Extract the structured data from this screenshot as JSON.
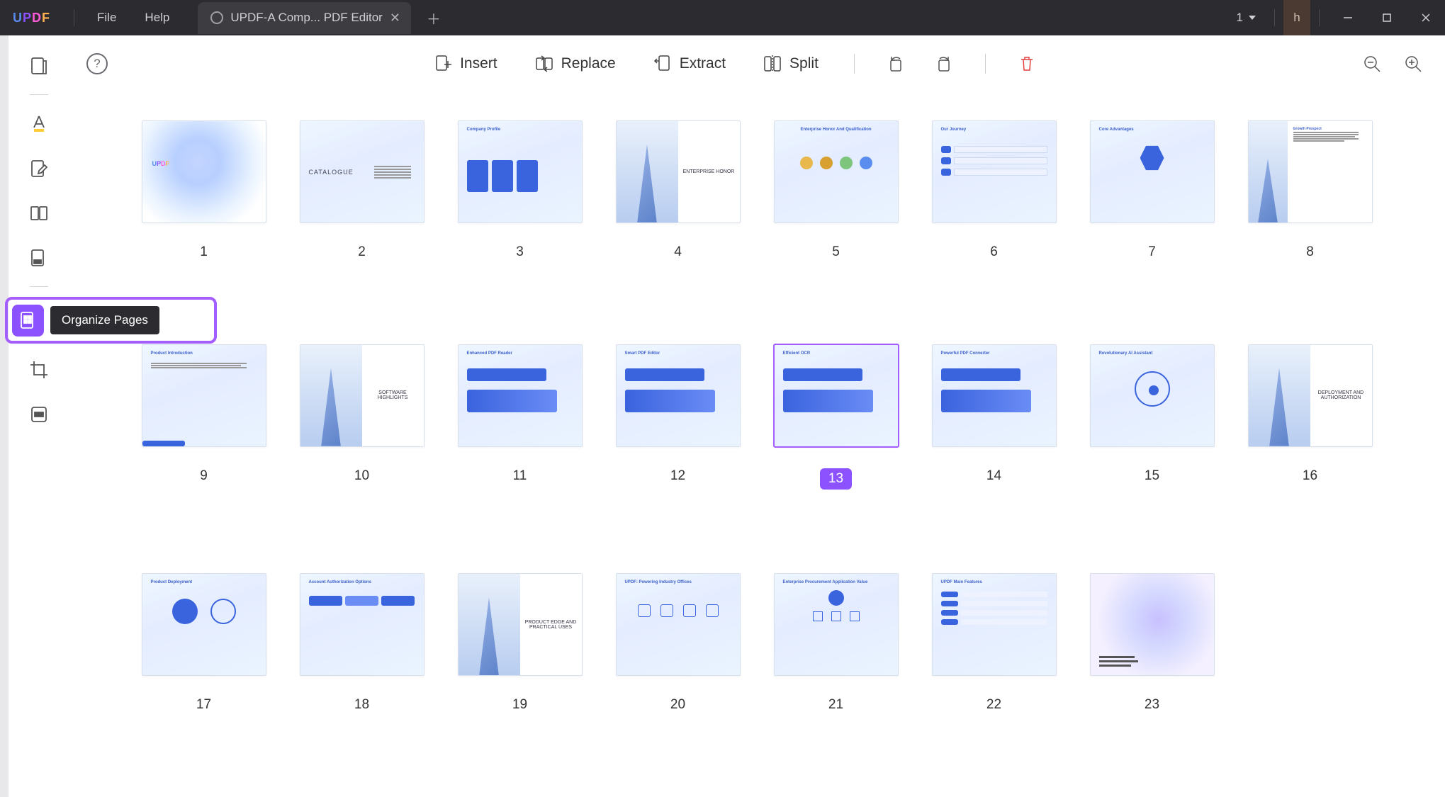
{
  "titlebar": {
    "logo_text": "UPDF",
    "menu": {
      "file": "File",
      "help": "Help"
    },
    "tab_title": "UPDF-A Comp... PDF Editor",
    "workspace_number": "1",
    "user_initial": "h"
  },
  "tooltip": {
    "organize_pages": "Organize Pages"
  },
  "toolbar": {
    "insert": "Insert",
    "replace": "Replace",
    "extract": "Extract",
    "split": "Split"
  },
  "pages": [
    {
      "num": "1",
      "kind": "cover",
      "title": "UPDF"
    },
    {
      "num": "2",
      "kind": "catalogue",
      "title": "CATALOGUE"
    },
    {
      "num": "3",
      "kind": "profile",
      "title": "Company Profile"
    },
    {
      "num": "4",
      "kind": "building_half",
      "title": "ENTERPRISE HONOR"
    },
    {
      "num": "5",
      "kind": "honor",
      "title": "Enterprise Honor And Qualification"
    },
    {
      "num": "6",
      "kind": "journey",
      "title": "Our Journey"
    },
    {
      "num": "7",
      "kind": "core",
      "title": "Core Advantages"
    },
    {
      "num": "8",
      "kind": "growth",
      "title": "Growth Prospect"
    },
    {
      "num": "9",
      "kind": "prodintro",
      "title": "Product Introduction"
    },
    {
      "num": "10",
      "kind": "building_half",
      "title": "SOFTWARE HIGHLIGHTS"
    },
    {
      "num": "11",
      "kind": "reader",
      "title": "Enhanced PDF Reader"
    },
    {
      "num": "12",
      "kind": "editor",
      "title": "Smart PDF Editor"
    },
    {
      "num": "13",
      "kind": "ocr",
      "title": "Efficient OCR",
      "selected": true
    },
    {
      "num": "14",
      "kind": "converter",
      "title": "Powerful PDF Converter"
    },
    {
      "num": "15",
      "kind": "ai",
      "title": "Revolutionary AI Assistant"
    },
    {
      "num": "16",
      "kind": "building_half",
      "title": "DEPLOYMENT AND AUTHORIZATION"
    },
    {
      "num": "17",
      "kind": "deploy",
      "title": "Product Deployment"
    },
    {
      "num": "18",
      "kind": "account",
      "title": "Account Authorization Options"
    },
    {
      "num": "19",
      "kind": "building_half",
      "title": "PRODUCT EDGE AND PRACTICAL USES"
    },
    {
      "num": "20",
      "kind": "industry",
      "title": "UPDF: Powering Industry Offices"
    },
    {
      "num": "21",
      "kind": "procure",
      "title": "Enterprise Procurement Application Value"
    },
    {
      "num": "22",
      "kind": "features",
      "title": "UPDF Main Features"
    },
    {
      "num": "23",
      "kind": "end",
      "title": ""
    }
  ]
}
